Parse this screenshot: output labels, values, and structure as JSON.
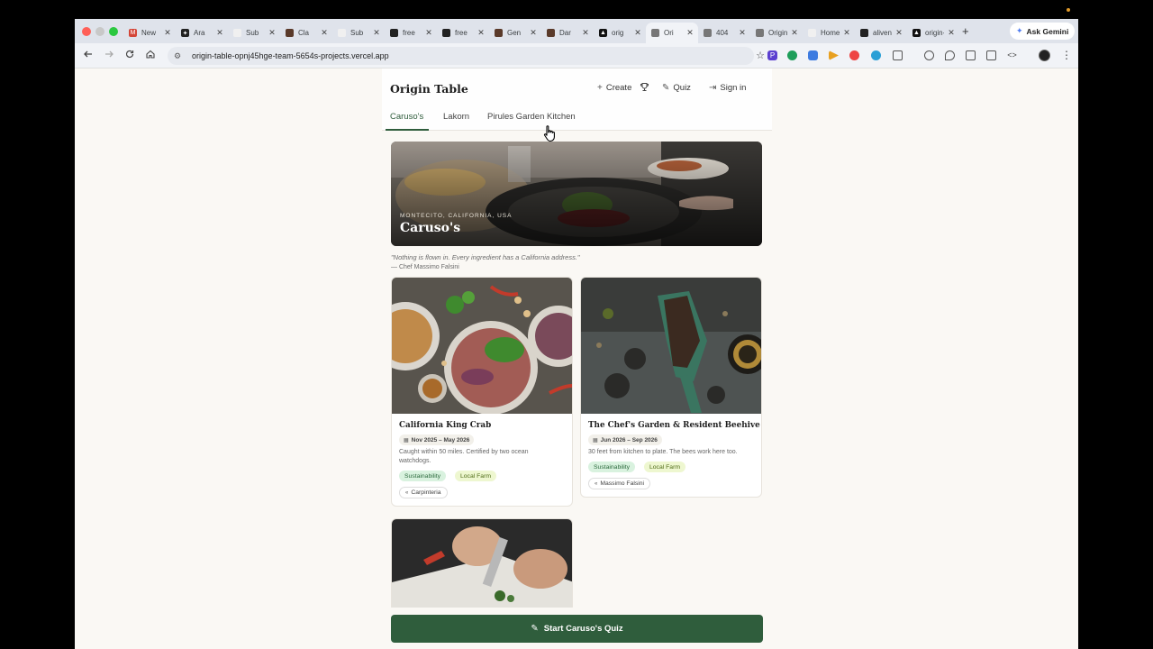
{
  "browser": {
    "tabs": [
      {
        "label": "New",
        "color": "#d44638",
        "glyph": "M"
      },
      {
        "label": "Ara",
        "color": "#222222",
        "glyph": "✦"
      },
      {
        "label": "Sub",
        "color": "#f0f0f0",
        "glyph": ""
      },
      {
        "label": "Cla",
        "color": "#5a3a2a",
        "glyph": ""
      },
      {
        "label": "Sub",
        "color": "#f0f0f0",
        "glyph": ""
      },
      {
        "label": "free",
        "color": "#222222",
        "glyph": ""
      },
      {
        "label": "free",
        "color": "#222222",
        "glyph": ""
      },
      {
        "label": "Gen",
        "color": "#5a3a2a",
        "glyph": ""
      },
      {
        "label": "Dar",
        "color": "#5a3a2a",
        "glyph": ""
      },
      {
        "label": "orig",
        "color": "#111111",
        "glyph": "▲"
      },
      {
        "label": "Ori",
        "color": "#777777",
        "glyph": ""
      },
      {
        "label": "404",
        "color": "#777777",
        "glyph": ""
      },
      {
        "label": "Origin T",
        "color": "#777777",
        "glyph": ""
      },
      {
        "label": "Home |",
        "color": "#f0f0f0",
        "glyph": ""
      },
      {
        "label": "alivenk",
        "color": "#222222",
        "glyph": ""
      },
      {
        "label": "origin-t",
        "color": "#111111",
        "glyph": "▲"
      }
    ],
    "active_tab_index": 10,
    "new_tab": "+",
    "gemini_label": "Ask Gemini",
    "url": "origin-table-opnj45hge-team-5654s-projects.vercel.app"
  },
  "header": {
    "brand": "Origin Table",
    "create": "Create",
    "quiz": "Quiz",
    "sign_in": "Sign in"
  },
  "subtabs": [
    "Caruso's",
    "Lakorn",
    "Pirules Garden Kitchen"
  ],
  "hero": {
    "location": "MONTECITO, CALIFORNIA, USA",
    "title": "Caruso's"
  },
  "quote": {
    "text": "\"Nothing is flown in. Every ingredient has a California address.\"",
    "by": "— Chef Massimo Falsini"
  },
  "cards": [
    {
      "title": "California King Crab",
      "dates": "Nov 2025 – May 2026",
      "desc": "Caught within 50 miles. Certified by two ocean watchdogs.",
      "tags": [
        "Sustainability",
        "Local Farm"
      ],
      "who": "Carpinteria"
    },
    {
      "title": "The Chef's Garden & Resident Beehive",
      "dates": "Jun 2026 – Sep 2026",
      "desc": "30 feet from kitchen to plate. The bees work here too.",
      "tags": [
        "Sustainability",
        "Local Farm"
      ],
      "who": "Massimo Falsini"
    }
  ],
  "quiz_button": "Start Caruso's Quiz",
  "colors": {
    "accent": "#2f5d3c",
    "page_bg": "#faf8f4",
    "tag_sustainability": "#d9f2df",
    "tag_farm": "#eef7d0"
  }
}
